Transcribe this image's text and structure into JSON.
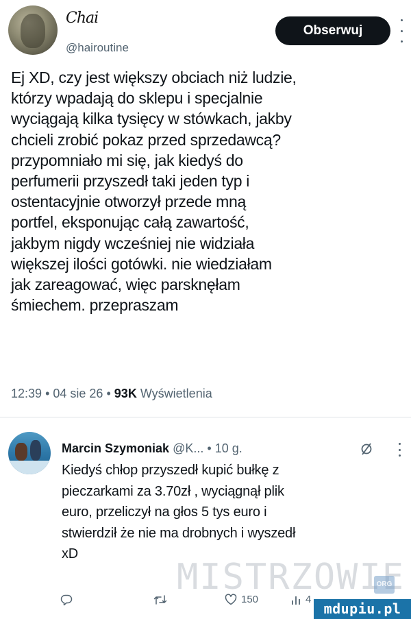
{
  "tweet": {
    "display_name": "Chai",
    "handle": "@hairoutine",
    "follow_label": "Obserwuj",
    "text_lines": [
      "Ej XD, czy jest większy obciach niż ludzie,",
      "którzy wpadają do sklepu i specjalnie",
      "wyciągają kilka tysięcy w stówkach, jakby",
      "chcieli zrobić pokaz przed sprzedawcą?",
      "przypomniało mi się, jak kiedyś do",
      "perfumerii przyszedł taki jeden typ i",
      "ostentacyjnie otworzył przede mną",
      "portfel, eksponując całą zawartość,",
      "jakbym nigdy wcześniej nie widziała",
      "większej ilości gotówki. nie wiedziałam",
      "jak zareagować, więc parsknęłam",
      "śmiechem. przepraszam"
    ],
    "time": "12:39",
    "date": "04 sie 26",
    "views_count": "93K",
    "views_label": "Wyświetlenia",
    "separator": "•"
  },
  "reply": {
    "name": "Marcin Szymoniak",
    "handle": "@K...",
    "age": "10 g.",
    "text_lines": [
      "Kiedyś chłop przyszedł kupić bułkę z",
      "pieczarkami za 3.70zł , wyciągnął plik",
      "euro, przeliczył na głos 5 tys euro i",
      "stwierdził że nie ma drobnych i wyszedł",
      "xD"
    ],
    "actions": {
      "likes": "150",
      "views": "4"
    }
  },
  "watermark": {
    "text": "MISTRZOWIE",
    "badge": "ORG",
    "logo": "mdupiu.pl"
  },
  "colors": {
    "text": "#0f1419",
    "secondary": "#536471",
    "button": "#0f1419",
    "logo_bg": "#1b73a8"
  }
}
